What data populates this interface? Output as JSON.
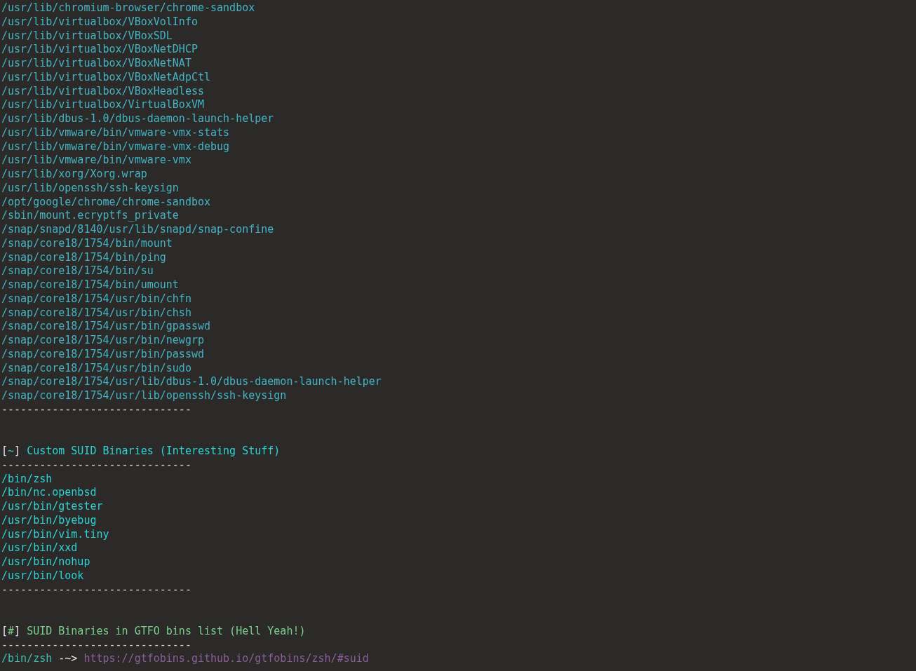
{
  "terminal": {
    "lines": [
      {
        "kind": "path",
        "text": "/usr/lib/chromium-browser/chrome-sandbox"
      },
      {
        "kind": "path",
        "text": "/usr/lib/virtualbox/VBoxVolInfo"
      },
      {
        "kind": "path",
        "text": "/usr/lib/virtualbox/VBoxSDL"
      },
      {
        "kind": "path",
        "text": "/usr/lib/virtualbox/VBoxNetDHCP"
      },
      {
        "kind": "path",
        "text": "/usr/lib/virtualbox/VBoxNetNAT"
      },
      {
        "kind": "path",
        "text": "/usr/lib/virtualbox/VBoxNetAdpCtl"
      },
      {
        "kind": "path",
        "text": "/usr/lib/virtualbox/VBoxHeadless"
      },
      {
        "kind": "path",
        "text": "/usr/lib/virtualbox/VirtualBoxVM"
      },
      {
        "kind": "path",
        "text": "/usr/lib/dbus-1.0/dbus-daemon-launch-helper"
      },
      {
        "kind": "path",
        "text": "/usr/lib/vmware/bin/vmware-vmx-stats"
      },
      {
        "kind": "path",
        "text": "/usr/lib/vmware/bin/vmware-vmx-debug"
      },
      {
        "kind": "path",
        "text": "/usr/lib/vmware/bin/vmware-vmx"
      },
      {
        "kind": "path",
        "text": "/usr/lib/xorg/Xorg.wrap"
      },
      {
        "kind": "path",
        "text": "/usr/lib/openssh/ssh-keysign"
      },
      {
        "kind": "path",
        "text": "/opt/google/chrome/chrome-sandbox"
      },
      {
        "kind": "path",
        "text": "/sbin/mount.ecryptfs_private"
      },
      {
        "kind": "path",
        "text": "/snap/snapd/8140/usr/lib/snapd/snap-confine"
      },
      {
        "kind": "path",
        "text": "/snap/core18/1754/bin/mount"
      },
      {
        "kind": "path",
        "text": "/snap/core18/1754/bin/ping"
      },
      {
        "kind": "path",
        "text": "/snap/core18/1754/bin/su"
      },
      {
        "kind": "path",
        "text": "/snap/core18/1754/bin/umount"
      },
      {
        "kind": "path",
        "text": "/snap/core18/1754/usr/bin/chfn"
      },
      {
        "kind": "path",
        "text": "/snap/core18/1754/usr/bin/chsh"
      },
      {
        "kind": "path",
        "text": "/snap/core18/1754/usr/bin/gpasswd"
      },
      {
        "kind": "path",
        "text": "/snap/core18/1754/usr/bin/newgrp"
      },
      {
        "kind": "path",
        "text": "/snap/core18/1754/usr/bin/passwd"
      },
      {
        "kind": "path",
        "text": "/snap/core18/1754/usr/bin/sudo"
      },
      {
        "kind": "path",
        "text": "/snap/core18/1754/usr/lib/dbus-1.0/dbus-daemon-launch-helper"
      },
      {
        "kind": "path",
        "text": "/snap/core18/1754/usr/lib/openssh/ssh-keysign"
      },
      {
        "kind": "separator",
        "text": "------------------------------"
      },
      {
        "kind": "blank"
      },
      {
        "kind": "blank"
      },
      {
        "kind": "header",
        "open": "[",
        "mark": "~",
        "close": "]",
        "title": "Custom SUID Binaries (Interesting Stuff)",
        "color": "#2ed3d3"
      },
      {
        "kind": "separator",
        "text": "------------------------------"
      },
      {
        "kind": "custom",
        "text": "/bin/zsh"
      },
      {
        "kind": "custom",
        "text": "/bin/nc.openbsd"
      },
      {
        "kind": "custom",
        "text": "/usr/bin/gtester"
      },
      {
        "kind": "custom",
        "text": "/usr/bin/byebug"
      },
      {
        "kind": "custom",
        "text": "/usr/bin/vim.tiny"
      },
      {
        "kind": "custom",
        "text": "/usr/bin/xxd"
      },
      {
        "kind": "custom",
        "text": "/usr/bin/nohup"
      },
      {
        "kind": "custom",
        "text": "/usr/bin/look"
      },
      {
        "kind": "separator",
        "text": "------------------------------"
      },
      {
        "kind": "blank"
      },
      {
        "kind": "blank"
      },
      {
        "kind": "header",
        "open": "[",
        "mark": "#",
        "close": "]",
        "title": "SUID Binaries in GTFO bins list (Hell Yeah!)",
        "color": "#7ccf8c"
      },
      {
        "kind": "separator",
        "text": "------------------------------"
      },
      {
        "kind": "link",
        "path": "/bin/zsh",
        "arrow": "-~>",
        "url": "https://gtfobins.github.io/gtfobins/zsh/#suid"
      }
    ]
  }
}
